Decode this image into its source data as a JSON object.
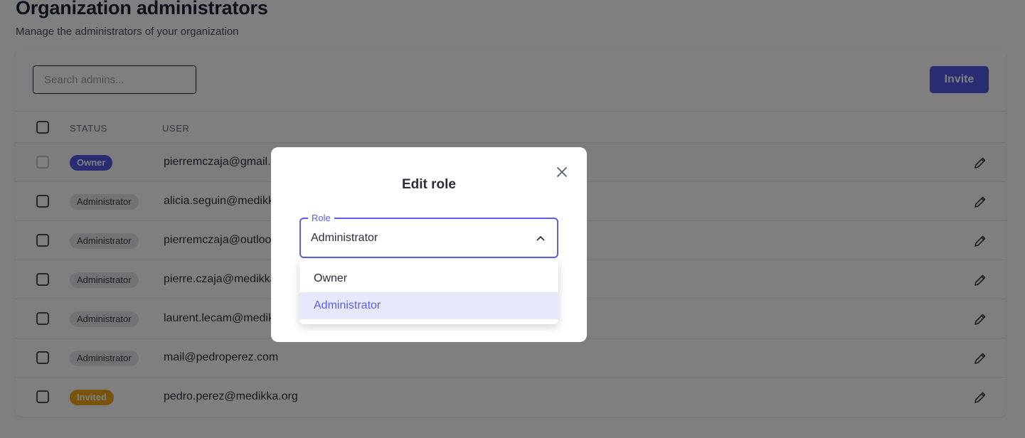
{
  "header": {
    "title": "Organization administrators",
    "subtitle": "Manage the administrators of your organization"
  },
  "toolbar": {
    "search_placeholder": "Search admins...",
    "invite_label": "Invite"
  },
  "table": {
    "columns": [
      "STATUS",
      "USER"
    ],
    "rows": [
      {
        "status": "Owner",
        "status_type": "owner",
        "email": "pierremczaja@gmail.c",
        "checkbox_disabled": true
      },
      {
        "status": "Administrator",
        "status_type": "admin",
        "email": "alicia.seguin@medikk",
        "checkbox_disabled": false
      },
      {
        "status": "Administrator",
        "status_type": "admin",
        "email": "pierremczaja@outloo",
        "checkbox_disabled": false
      },
      {
        "status": "Administrator",
        "status_type": "admin",
        "email": "pierre.czaja@medikka",
        "checkbox_disabled": false
      },
      {
        "status": "Administrator",
        "status_type": "admin",
        "email": "laurent.lecam@medik",
        "checkbox_disabled": false
      },
      {
        "status": "Administrator",
        "status_type": "admin",
        "email": "mail@pedroperez.com",
        "checkbox_disabled": false
      },
      {
        "status": "Invited",
        "status_type": "invited",
        "email": "pedro.perez@medikka.org",
        "checkbox_disabled": false
      }
    ]
  },
  "modal": {
    "title": "Edit role",
    "field_label": "Role",
    "selected_value": "Administrator",
    "options": [
      "Owner",
      "Administrator"
    ],
    "selected_index": 1
  },
  "colors": {
    "accent": "#5458e8",
    "invited": "#f2a91a",
    "admin_badge": "#e6e7ea"
  }
}
